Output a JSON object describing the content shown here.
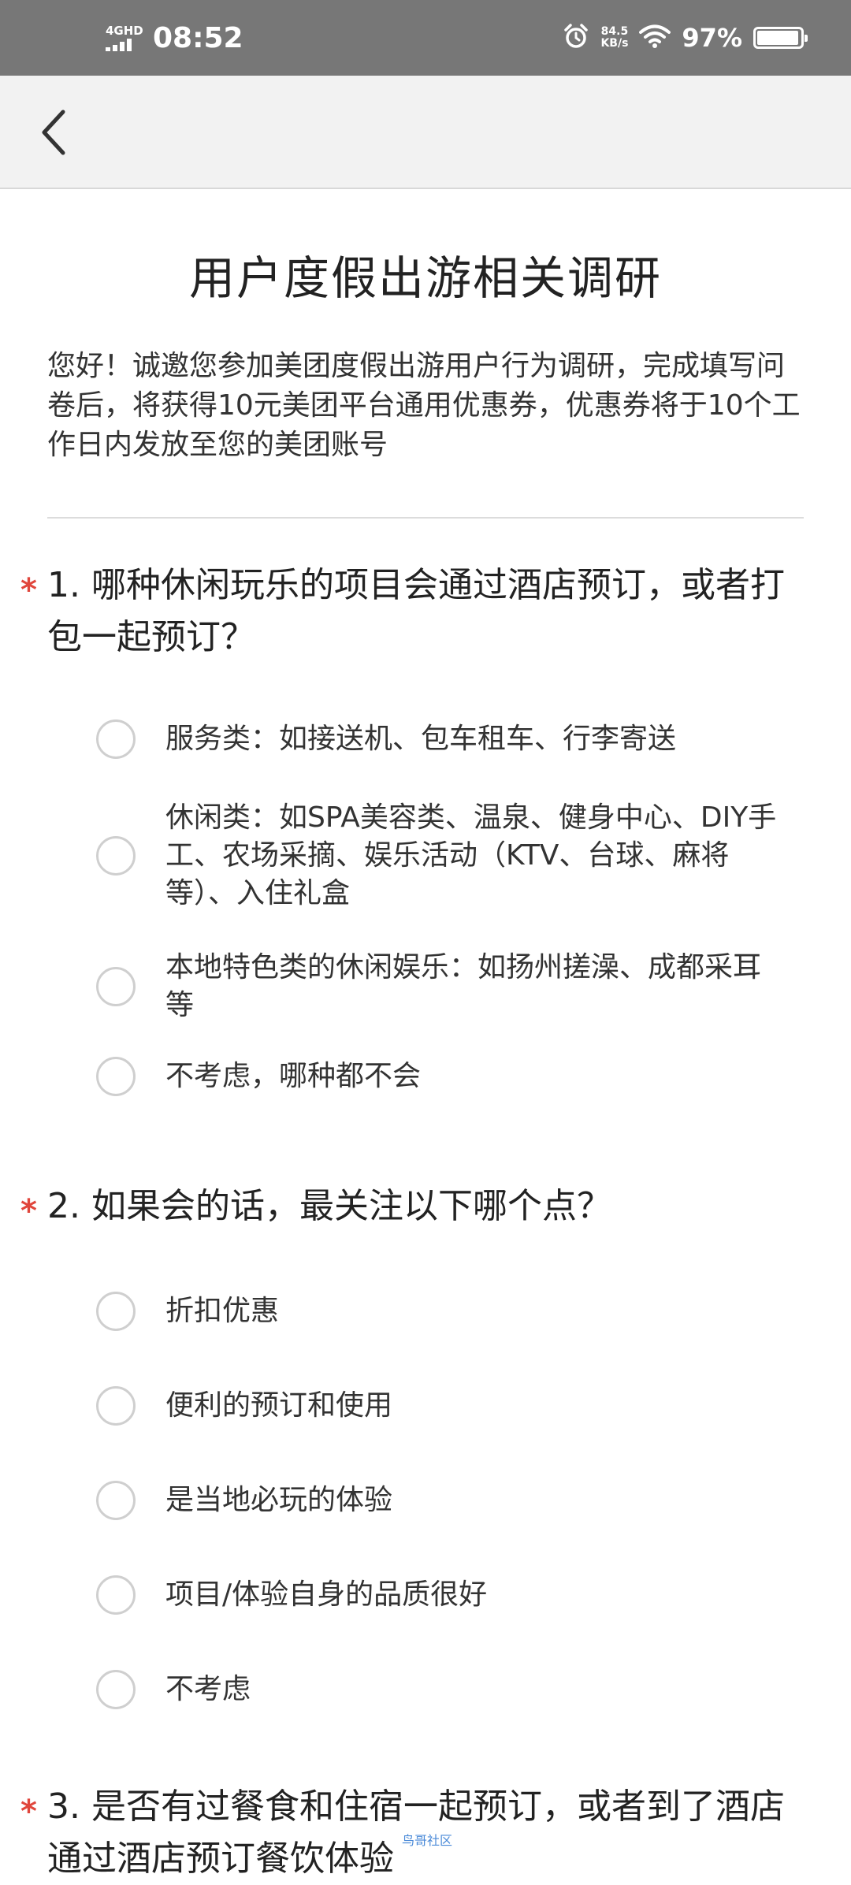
{
  "status_bar": {
    "network": "4GHD",
    "time": "08:52",
    "speed_value": "84.5",
    "speed_unit": "KB/s",
    "battery": "97%",
    "battery_level": 0.97
  },
  "nav": {
    "back_icon": "chevron-left-icon"
  },
  "survey": {
    "title": "用户度假出游相关调研",
    "intro": "您好！诚邀您参加美团度假出游用户行为调研，完成填写问卷后，将获得10元美团平台通用优惠券，优惠券将于10个工作日内发放至您的美团账号",
    "required_marker": "*",
    "questions": [
      {
        "title": "1. 哪种休闲玩乐的项目会通过酒店预订，或者打包一起预订？",
        "options": [
          "服务类：如接送机、包车租车、行李寄送",
          "休闲类：如SPA美容类、温泉、健身中心、DIY手工、农场采摘、娱乐活动（KTV、台球、麻将等）、入住礼盒",
          "本地特色类的休闲娱乐：如扬州搓澡、成都采耳等",
          "不考虑，哪种都不会"
        ]
      },
      {
        "title": "2. 如果会的话，最关注以下哪个点？",
        "options": [
          "折扣优惠",
          "便利的预订和使用",
          "是当地必玩的体验",
          "项目/体验自身的品质很好",
          "不考虑"
        ]
      },
      {
        "title": "3.  是否有过餐食和住宿一起预订，或者到了酒店通过酒店预订餐饮体验"
      }
    ]
  },
  "watermark": "鸟哥社区",
  "colors": {
    "status_bar_bg": "#777777",
    "nav_bg": "#f2f2f2",
    "required_star": "#e0463c",
    "radio_border": "#cfcfcf"
  }
}
